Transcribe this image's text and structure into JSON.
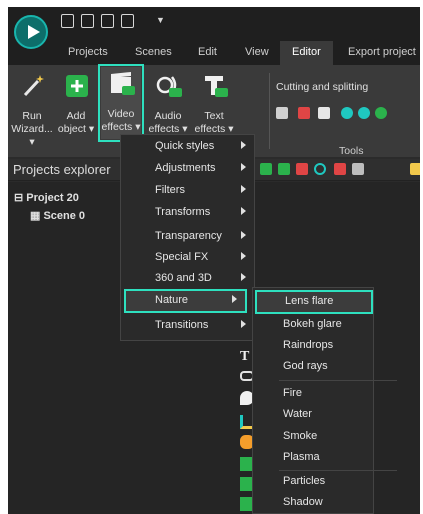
{
  "tabs": [
    "Projects",
    "Scenes",
    "Edit",
    "View",
    "Editor",
    "Export project"
  ],
  "active_tab": "Editor",
  "ribbon": {
    "run_wizard": "Run Wizard... ▾",
    "add_object": "Add object ▾",
    "video_effects": "Video effects ▾",
    "audio_effects": "Audio effects ▾",
    "text_effects": "Text effects ▾",
    "cutting": "Cutting and splitting",
    "tools_group": "Tools",
    "fx_badge": "FX"
  },
  "projects_panel": {
    "title": "Projects explorer",
    "project": "Project 20",
    "scene": "Scene 0"
  },
  "video_effects_menu": {
    "items": [
      {
        "label": "Quick styles"
      },
      {
        "label": "Adjustments"
      },
      {
        "label": "Filters"
      },
      {
        "label": "Transforms"
      },
      {
        "label": "Transparency"
      },
      {
        "label": "Special FX"
      },
      {
        "label": "360 and 3D"
      },
      {
        "label": "Nature"
      },
      {
        "label": "Transitions"
      }
    ],
    "highlighted": "Nature"
  },
  "nature_submenu": {
    "items": [
      {
        "label": "Lens flare"
      },
      {
        "label": "Bokeh glare"
      },
      {
        "label": "Raindrops"
      },
      {
        "label": "God rays"
      },
      {
        "label": "Fire"
      },
      {
        "label": "Water"
      },
      {
        "label": "Smoke"
      },
      {
        "label": "Plasma"
      },
      {
        "label": "Particles"
      },
      {
        "label": "Shadow"
      }
    ],
    "highlighted": "Lens flare"
  },
  "colors": {
    "accent": "#2ee0bf",
    "brand": "#0d6e6a"
  }
}
